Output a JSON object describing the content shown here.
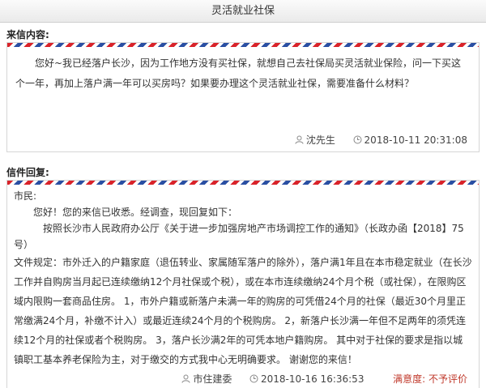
{
  "page": {
    "title": "灵活就业社保"
  },
  "letter": {
    "section_label": "来信内容:",
    "body": "您好~我已经落户长沙，因为工作地方没有买社保，就想自己去社保局买灵活就业保险，问一下买这个一年，再加上落户满一年可以买房吗？如果要办理这个灵活就业社保，需要准备什么材料？",
    "author": "沈先生",
    "timestamp": "2018-10-11 20:31:08"
  },
  "reply": {
    "section_label": "信件回复:",
    "salutation": "市民:",
    "greeting": "您好！您的来信已收悉。经调查，现回复如下：",
    "line1": "按照长沙市人民政府办公厅《关于进一步加强房地产市场调控工作的通知》（长政办函【2018】75号）",
    "body": "文件规定：市外迁入的户籍家庭（退伍转业、家属随军落户的除外），落户满1年且在本市稳定就业（在长沙工作并自购房当月起已连续缴纳12个月社保或个税），或在本市连续缴纳24个月个税（或社保），在限购区域内限购一套商品住房。 1，市外户籍或新落户未满一年的购房的可凭借24个月的社保（最近30个月里正常缴满24个月，补缴不计入）或最近连续24个月的个税购房。 2，新落户长沙满一年但不足两年的须凭连续12个月的社保或者个税购房。 3，落户长沙满2年的可凭本地户籍购房。 其中对于社保的要求是指以城镇职工基本养老保险为主，对于缴交的方式我中心无明确要求。 谢谢您的来信！",
    "author": "市住建委",
    "timestamp": "2018-10-16 16:36:53",
    "rating_label": "满意度:",
    "rating_value": "不予评价"
  }
}
